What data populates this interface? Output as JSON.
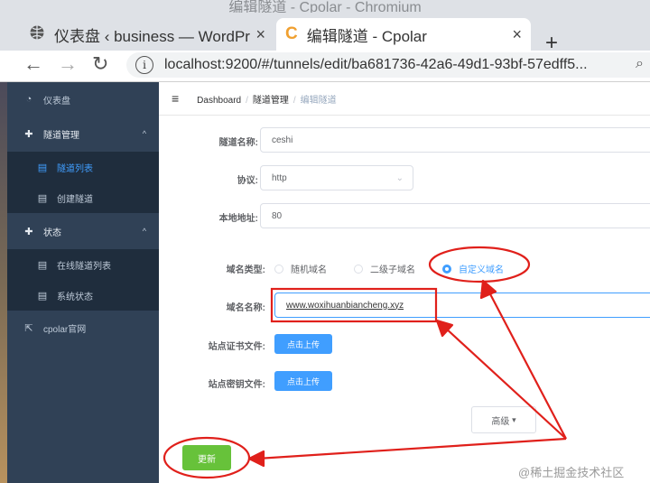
{
  "window": {
    "title": "编辑隧道 - Cpolar - Chromium"
  },
  "tabs": [
    {
      "title": "仪表盘 ‹ business — WordPress",
      "close": "×",
      "icon": "globe-icon"
    },
    {
      "title": "编辑隧道 - Cpolar",
      "close": "×",
      "icon": "cpolar-c-icon",
      "favicon_glyph": "C"
    }
  ],
  "browser": {
    "new_tab": "+",
    "back": "←",
    "forward": "→",
    "reload": "↻",
    "info": "i",
    "zoom": "⌕",
    "url": "localhost:9200/#/tunnels/edit/ba681736-42a6-49d1-93bf-57edff5..."
  },
  "sidebar": {
    "items": [
      {
        "label": "仪表盘",
        "icon": "dashboard-icon",
        "glyph": "◔"
      },
      {
        "label": "隧道管理",
        "icon": "plus-circle-icon",
        "glyph": "✚",
        "arrow": "^"
      },
      {
        "label": "隧道列表",
        "icon": "list-icon",
        "glyph": "▤",
        "active": true
      },
      {
        "label": "创建隧道",
        "icon": "list-icon",
        "glyph": "▤"
      },
      {
        "label": "状态",
        "icon": "plus-circle-icon",
        "glyph": "✚",
        "arrow": "^"
      },
      {
        "label": "在线隧道列表",
        "icon": "list-icon",
        "glyph": "▤"
      },
      {
        "label": "系统状态",
        "icon": "list-icon",
        "glyph": "▤"
      },
      {
        "label": "cpolar官网",
        "icon": "external-link-icon",
        "glyph": "⇱"
      }
    ]
  },
  "header": {
    "menu_icon": "≡",
    "breadcrumb": [
      "Dashboard",
      "隧道管理",
      "编辑隧道"
    ],
    "sep": "/"
  },
  "form": {
    "tunnel_name_label": "隧道名称:",
    "tunnel_name_value": "ceshi",
    "protocol_label": "协议:",
    "protocol_value": "http",
    "protocol_chevron": "⌄",
    "local_addr_label": "本地地址:",
    "local_addr_value": "80",
    "domain_type_label": "域名类型:",
    "domain_type_options": [
      "随机域名",
      "二级子域名",
      "自定义域名"
    ],
    "domain_type_selected": "自定义域名",
    "domain_name_label": "域名名称:",
    "domain_name_value": "www.woxihuanbiancheng.xyz",
    "cert_label": "站点证书文件:",
    "cert_button": "点击上传",
    "key_label": "站点密钥文件:",
    "key_button": "点击上传",
    "advanced_button": "高级",
    "advanced_caret": "▾",
    "update_button": "更新"
  },
  "watermark": "@稀土掘金技术社区",
  "colors": {
    "sidebar_bg": "#304156",
    "sidebar_sub_bg": "#1f2d3d",
    "accent": "#409eff",
    "success": "#67c23a",
    "annotation_red": "#e0201b"
  }
}
